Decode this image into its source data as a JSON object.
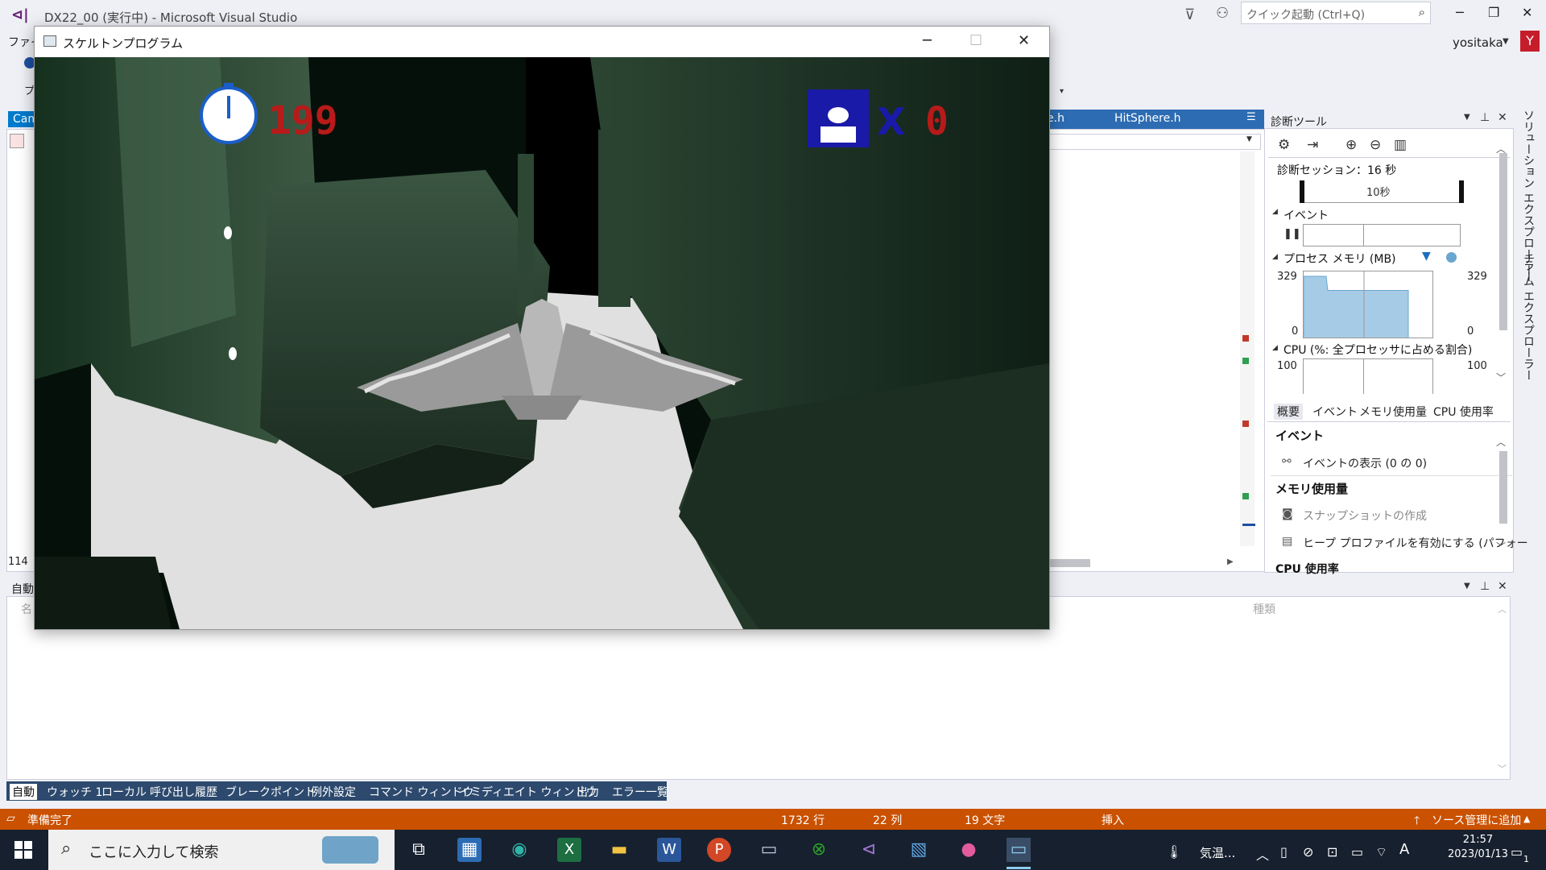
{
  "vs": {
    "title": "DX22_00 (実行中) - Microsoft Visual Studio",
    "quick_launch_placeholder": "クイック起動 (Ctrl+Q)",
    "user": "yositaka",
    "user_initial": "Y",
    "menu_partial": "ファイ",
    "toolbar_partial": "プ",
    "tabs": {
      "left_partial": "Cam",
      "right_partial": "e.h",
      "hitsphere": "HitSphere.h"
    },
    "line_partial": "114"
  },
  "game": {
    "window_title": "スケルトンプログラム",
    "timer_value": "199",
    "lives_multiplier": "X",
    "lives_value": "0"
  },
  "diag": {
    "title": "診断ツール",
    "session": "診断セッション：16 秒",
    "timeline_label": "10秒",
    "events_label": "イベント",
    "memory_label": "プロセス メモリ (MB)",
    "memory_max_left": "329",
    "memory_min_left": "0",
    "memory_max_right": "329",
    "memory_min_right": "0",
    "cpu_label": "CPU (%: 全プロセッサに占める割合)",
    "cpu_max_left": "100",
    "cpu_max_right": "100",
    "tabs": [
      "概要",
      "イベント",
      "メモリ使用量",
      "CPU 使用率"
    ],
    "sec_events": "イベント",
    "show_events": "イベントの表示 (0 の 0)",
    "sec_memory": "メモリ使用量",
    "snapshot": "スナップショットの作成",
    "heap": "ヒープ プロファイルを有効にする (パフォー",
    "sec_cpu": "CPU 使用率",
    "memory_usage_pct": 72,
    "memory_accent": "#a6cbe6"
  },
  "side_labels": {
    "solution": "ソリューション エクスプローラー",
    "team": "チーム エクスプローラー"
  },
  "bottom": {
    "auto_title": "自動",
    "col_name": "名",
    "col_kind": "種類",
    "tabs": [
      "自動",
      "ウォッチ 1",
      "ローカル",
      "呼び出し履歴",
      "ブレークポイント",
      "例外設定",
      "コマンド ウィンドウ",
      "イミディエイト ウィンドウ",
      "出力",
      "エラー一覧"
    ]
  },
  "status": {
    "ready": "準備完了",
    "line": "1732 行",
    "col": "22 列",
    "chars": "19 文字",
    "mode": "挿入",
    "source_control": "ソース管理に追加"
  },
  "taskbar": {
    "search_placeholder": "ここに入力して検索",
    "weather": "気温...",
    "time": "21:57",
    "date": "2023/01/13",
    "notifications": "1"
  },
  "colors": {
    "vs_accent": "#007acc",
    "status_orange": "#ca5100",
    "hud_blue": "#1a1aa8",
    "hud_red": "#b81a1a"
  }
}
